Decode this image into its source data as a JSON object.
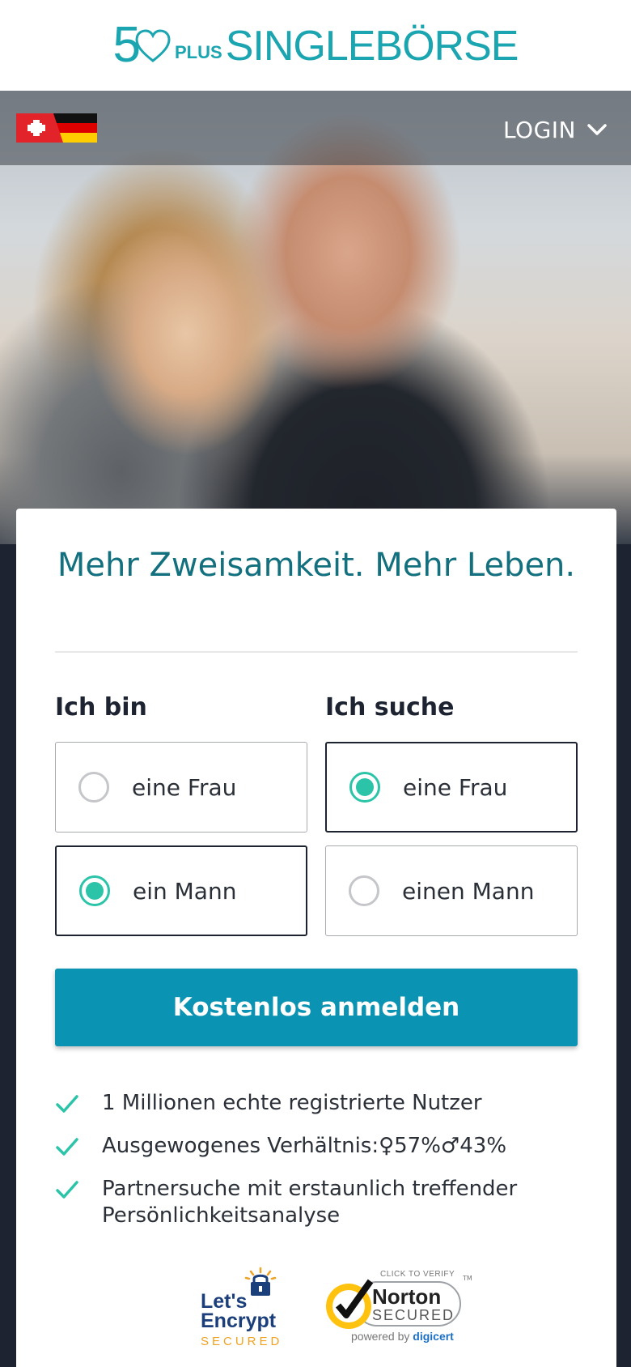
{
  "header": {
    "logo_number": "5",
    "logo_plus": "PLUS",
    "logo_brand": "SINGLEBÖRSE",
    "brand_color": "#1aa5b0"
  },
  "topbar": {
    "flags": [
      "swiss-flag",
      "german-flag"
    ],
    "login_label": "LOGIN"
  },
  "card": {
    "headline": "Mehr Zweisamkeit. Mehr Leben.",
    "i_am": {
      "title": "Ich bin",
      "options": [
        {
          "label": "eine Frau",
          "selected": false
        },
        {
          "label": "ein Mann",
          "selected": true
        }
      ]
    },
    "looking_for": {
      "title": "Ich suche",
      "options": [
        {
          "label": "eine Frau",
          "selected": true
        },
        {
          "label": "einen Mann",
          "selected": false
        }
      ]
    },
    "cta_label": "Kostenlos anmelden",
    "cta_color": "#0a93b2",
    "accent_color": "#2bc4a8",
    "bullets": [
      "1 Millionen echte registrierte Nutzer",
      "Ausgewogenes Verhältnis:♀57%♂43%",
      "Partnersuche mit erstaunlich treffender Persönlichkeitsanalyse"
    ]
  },
  "badges": {
    "letsencrypt_line1": "Let's",
    "letsencrypt_line2": "Encrypt",
    "letsencrypt_secured": "SECURED",
    "norton_click": "CLICK TO VERIFY",
    "norton_name": "Norton",
    "norton_secured": "SECURED",
    "norton_powered": "powered by",
    "norton_powered_brand": "digicert",
    "norton_tm": "TM"
  }
}
